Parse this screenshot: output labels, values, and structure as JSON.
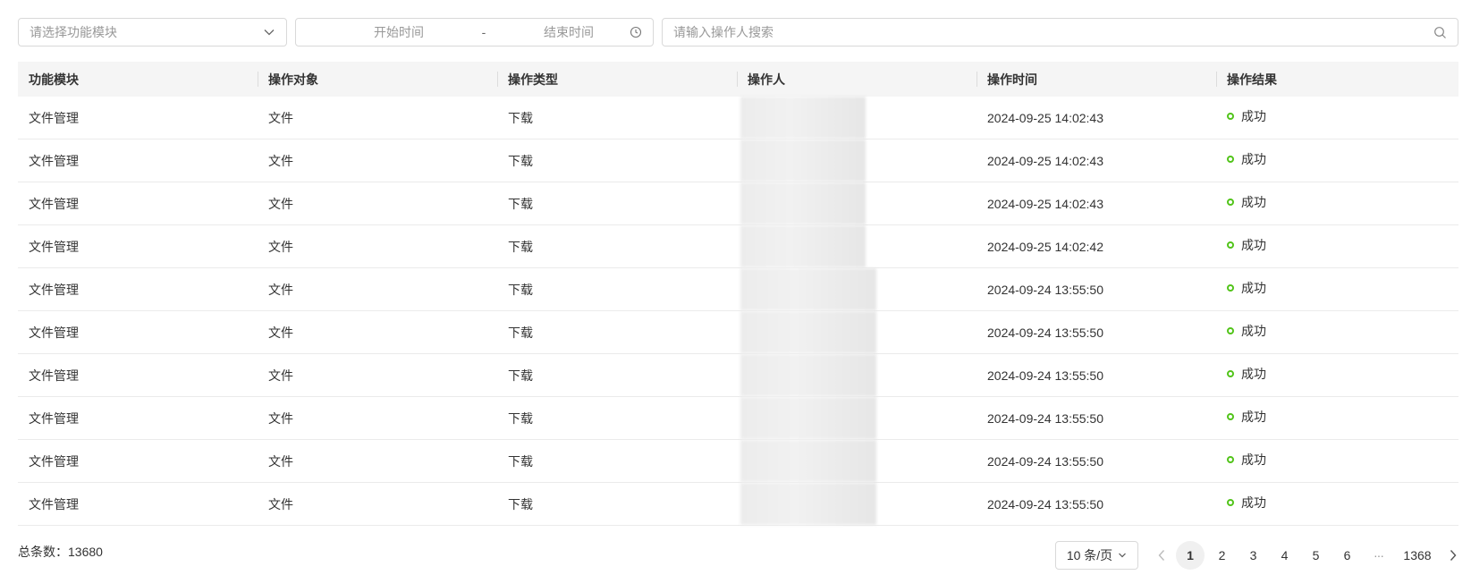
{
  "filters": {
    "module_placeholder": "请选择功能模块",
    "start_placeholder": "开始时间",
    "date_separator": "-",
    "end_placeholder": "结束时间",
    "search_placeholder": "请输入操作人搜索"
  },
  "table": {
    "columns": [
      "功能模块",
      "操作对象",
      "操作类型",
      "操作人",
      "操作时间",
      "操作结果"
    ],
    "rows": [
      {
        "module": "文件管理",
        "object": "文件",
        "type": "下载",
        "time": "2024-09-25 14:02:43",
        "result": "成功"
      },
      {
        "module": "文件管理",
        "object": "文件",
        "type": "下载",
        "time": "2024-09-25 14:02:43",
        "result": "成功"
      },
      {
        "module": "文件管理",
        "object": "文件",
        "type": "下载",
        "time": "2024-09-25 14:02:43",
        "result": "成功"
      },
      {
        "module": "文件管理",
        "object": "文件",
        "type": "下载",
        "time": "2024-09-25 14:02:42",
        "result": "成功"
      },
      {
        "module": "文件管理",
        "object": "文件",
        "type": "下载",
        "time": "2024-09-24 13:55:50",
        "result": "成功"
      },
      {
        "module": "文件管理",
        "object": "文件",
        "type": "下载",
        "time": "2024-09-24 13:55:50",
        "result": "成功"
      },
      {
        "module": "文件管理",
        "object": "文件",
        "type": "下载",
        "time": "2024-09-24 13:55:50",
        "result": "成功"
      },
      {
        "module": "文件管理",
        "object": "文件",
        "type": "下载",
        "time": "2024-09-24 13:55:50",
        "result": "成功"
      },
      {
        "module": "文件管理",
        "object": "文件",
        "type": "下载",
        "time": "2024-09-24 13:55:50",
        "result": "成功"
      },
      {
        "module": "文件管理",
        "object": "文件",
        "type": "下载",
        "time": "2024-09-24 13:55:50",
        "result": "成功"
      }
    ]
  },
  "footer": {
    "total_label": "总条数：13680"
  },
  "pagination": {
    "page_size": "10 条/页",
    "pages": [
      "1",
      "2",
      "3",
      "4",
      "5",
      "6"
    ],
    "ellipsis": "···",
    "last_page": "1368",
    "current_page": "1"
  },
  "colors": {
    "success": "#52c41a",
    "header_bg": "#f5f5f5"
  },
  "icons": {
    "module_select": "chevron-down-icon",
    "date_range": "clock-icon",
    "search": "search-icon",
    "prev": "chevron-left-icon",
    "next": "chevron-right-icon"
  }
}
